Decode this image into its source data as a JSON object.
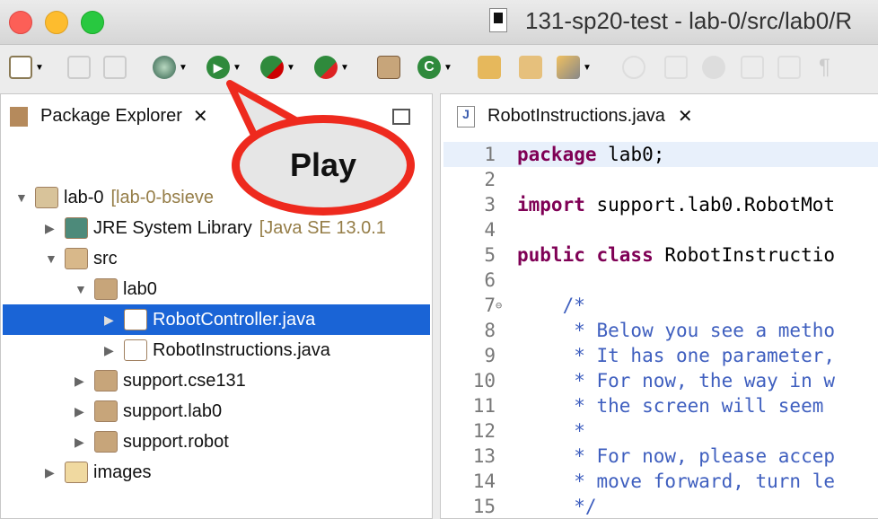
{
  "window": {
    "title": "131-sp20-test - lab-0/src/lab0/R"
  },
  "toolbar": {
    "items": [
      "new-wizard",
      "save",
      "save-all",
      "debug",
      "run",
      "coverage",
      "external-tools",
      "new-java-package",
      "new-java-class",
      "open-type",
      "open-task",
      "search",
      "toggle-mark",
      "pen",
      "share",
      "diff",
      "outline",
      "pilcrow"
    ]
  },
  "explorer": {
    "tab_label": "Package Explorer",
    "tree": [
      {
        "label": "lab-0",
        "decoration": "[lab-0-bsieve",
        "depth": 0,
        "expanded": true,
        "icon": "java-project-icon"
      },
      {
        "label": "JRE System Library",
        "decoration": "[Java SE 13.0.1",
        "depth": 1,
        "expanded": false,
        "icon": "library-icon"
      },
      {
        "label": "src",
        "depth": 1,
        "expanded": true,
        "icon": "source-folder-icon"
      },
      {
        "label": "lab0",
        "depth": 2,
        "expanded": true,
        "icon": "package-icon"
      },
      {
        "label": "RobotController.java",
        "depth": 3,
        "expanded": false,
        "selected": true,
        "icon": "java-file-icon"
      },
      {
        "label": "RobotInstructions.java",
        "depth": 3,
        "expanded": false,
        "icon": "java-file-icon"
      },
      {
        "label": "support.cse131",
        "depth": 2,
        "expanded": false,
        "icon": "package-icon"
      },
      {
        "label": "support.lab0",
        "depth": 2,
        "expanded": false,
        "icon": "package-icon"
      },
      {
        "label": "support.robot",
        "depth": 2,
        "expanded": false,
        "icon": "package-icon"
      },
      {
        "label": "images",
        "depth": 1,
        "expanded": false,
        "icon": "folder-icon"
      }
    ]
  },
  "editor": {
    "tab_label": "RobotInstructions.java",
    "lines": [
      {
        "n": "1",
        "kw": "package",
        "rest": " lab0;"
      },
      {
        "n": "2",
        "kw": "",
        "rest": ""
      },
      {
        "n": "3",
        "kw": "import",
        "rest": " support.lab0.RobotMot"
      },
      {
        "n": "4",
        "kw": "",
        "rest": ""
      },
      {
        "n": "5",
        "kw": "public class",
        "rest": " RobotInstructio"
      },
      {
        "n": "6",
        "kw": "",
        "rest": ""
      },
      {
        "n": "7",
        "cm": "    /*"
      },
      {
        "n": "8",
        "cm": "     * Below you see a metho"
      },
      {
        "n": "9",
        "cm": "     * It has one parameter,"
      },
      {
        "n": "10",
        "cm": "     * For now, the way in w"
      },
      {
        "n": "11",
        "cm": "     * the screen will seem"
      },
      {
        "n": "12",
        "cm": "     *"
      },
      {
        "n": "13",
        "cm": "     * For now, please accep"
      },
      {
        "n": "14",
        "cm": "     * move forward, turn le"
      },
      {
        "n": "15",
        "cm": "     */"
      }
    ]
  },
  "callout": {
    "text": "Play"
  },
  "colors": {
    "selection": "#1a64d6",
    "keyword": "#7f0055",
    "comment": "#3f5fbf",
    "callout_border": "#ee2a1e"
  }
}
